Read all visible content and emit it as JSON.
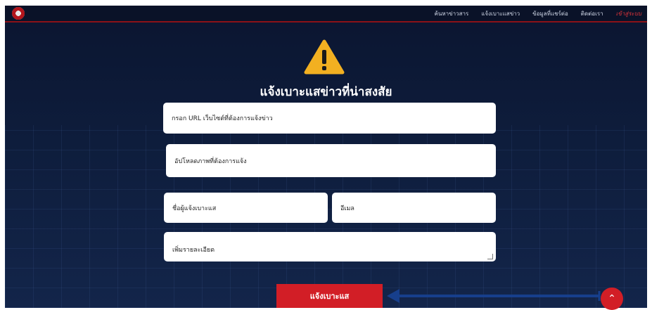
{
  "nav": {
    "items": [
      "ค้นหาข่าวสาร",
      "แจ้งเบาะแสข่าว",
      "ข้อมูลที่แชร์ต่อ",
      "ติดต่อเรา"
    ],
    "active": "เข้าสู่ระบบ"
  },
  "warning_icon": "warning-triangle-icon",
  "page": {
    "title": "แจ้งเบาะแสข่าวที่น่าสงสัย"
  },
  "form": {
    "url_placeholder": "กรอก URL เว็บไซต์ที่ต้องการแจ้งข่าว",
    "upload_label": "อัปโหลดภาพที่ต้องการแจ้ง",
    "name_placeholder": "ชื่อผู้แจ้งเบาะแส",
    "email_placeholder": "อีเมล",
    "detail_placeholder": "เพิ่มรายละเอียด",
    "submit_label": "แจ้งเบาะแส"
  },
  "colors": {
    "accent": "#d21e26",
    "background": "#0e1d3c",
    "warning": "#f2b021"
  }
}
